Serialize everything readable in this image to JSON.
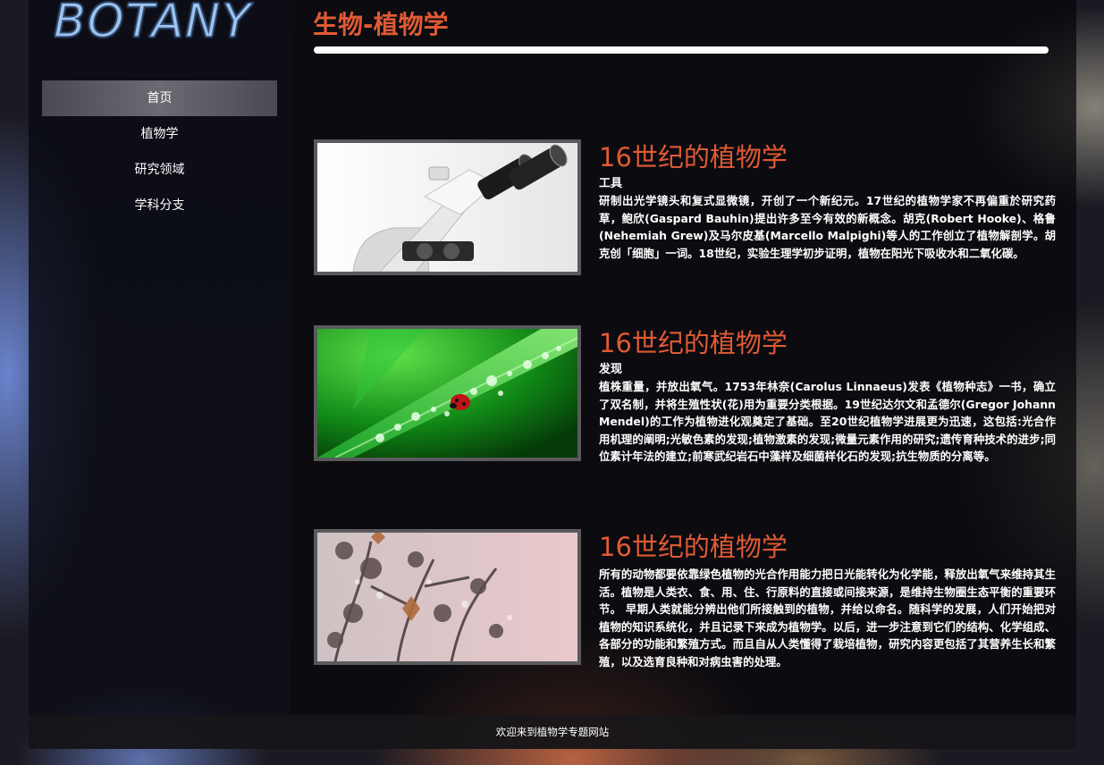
{
  "logo": {
    "text": "BOTANY"
  },
  "nav": {
    "items": [
      {
        "label": "首页",
        "active": true
      },
      {
        "label": "植物学",
        "active": false
      },
      {
        "label": "研究领域",
        "active": false
      },
      {
        "label": "学科分支",
        "active": false
      }
    ]
  },
  "page": {
    "title": "生物-植物学"
  },
  "articles": [
    {
      "title": "16世纪的植物学",
      "subtitle": "工具",
      "body": "研制出光学镜头和复式显微镜，开创了一个新纪元。17世纪的植物学家不再偏重於研究药草，鲍欣(Gaspard Bauhin)提出许多至今有效的新概念。胡克(Robert Hooke)、格鲁(Nehemiah Grew)及马尔皮基(Marcello Malpighi)等人的工作创立了植物解剖学。胡克创「细胞」一词。18世纪，实验生理学初步证明，植物在阳光下吸收水和二氧化碳。",
      "image": "microscope-image"
    },
    {
      "title": "16世纪的植物学",
      "subtitle": "发现",
      "body": "植株重量，并放出氧气。1753年林奈(Carolus Linnaeus)发表《植物种志》一书，确立了双名制，并将生殖性状(花)用为重要分类根据。19世纪达尔文和孟德尔(Gregor Johann Mendel)的工作为植物进化观奠定了基础。至20世纪植物学进展更为迅速，这包括:光合作用机理的阐明;光敏色素的发现;植物激素的发现;微量元素作用的研究;遗传育种技术的进步;同位素计年法的建立;前寒武纪岩石中藻样及细菌样化石的发现;抗生物质的分离等。",
      "image": "ladybug-leaf-image"
    },
    {
      "title": "16世纪的植物学",
      "subtitle": "",
      "body": "所有的动物都要依靠绿色植物的光合作用能力把日光能转化为化学能，释放出氧气来维持其生活。植物是人类衣、食、用、住、行原料的直接或间接来源，是维持生物圈生态平衡的重要环节。 早期人类就能分辨出他们所接触到的植物，并给以命名。随科学的发展，人们开始把对植物的知识系统化，并且记录下来成为植物学。以后，进一步注意到它们的结构、化学组成、各部分的功能和繁殖方式。而且自从人类懂得了栽培植物，研究内容更包括了其营养生长和繁殖，以及选育良种和对病虫害的处理。",
      "image": "frozen-flowers-image"
    }
  ],
  "footer": {
    "text": "欢迎来到植物学专题网站"
  },
  "colors": {
    "accent": "#e05a34",
    "logo": "#9ec4f0",
    "active_nav": "#5a5a62"
  }
}
